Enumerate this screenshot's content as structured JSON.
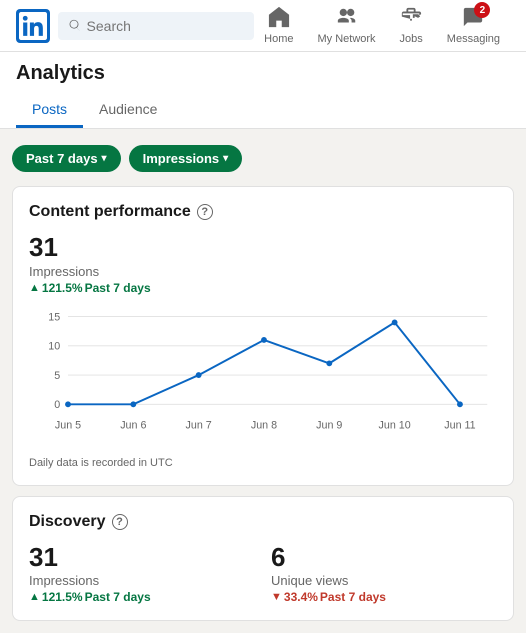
{
  "header": {
    "logo_alt": "LinkedIn",
    "search_placeholder": "Search",
    "nav": [
      {
        "id": "home",
        "label": "Home",
        "badge": null
      },
      {
        "id": "my-network",
        "label": "My Network",
        "badge": null
      },
      {
        "id": "jobs",
        "label": "Jobs",
        "badge": null
      },
      {
        "id": "messaging",
        "label": "Messaging",
        "badge": "2"
      }
    ]
  },
  "page": {
    "title": "Analytics",
    "tabs": [
      {
        "id": "posts",
        "label": "Posts",
        "active": true
      },
      {
        "id": "audience",
        "label": "Audience",
        "active": false
      }
    ]
  },
  "filters": [
    {
      "id": "date-range",
      "label": "Past 7 days"
    },
    {
      "id": "metric",
      "label": "Impressions"
    }
  ],
  "content_performance": {
    "title": "Content performance",
    "help_icon": "?",
    "metric_value": "31",
    "metric_label": "Impressions",
    "metric_change": "121.5%",
    "metric_change_period": "Past 7 days",
    "chart": {
      "y_max": 15,
      "y_labels": [
        "15",
        "10",
        "5",
        "0"
      ],
      "x_labels": [
        "Jun 5",
        "Jun 6",
        "Jun 7",
        "Jun 8",
        "Jun 9",
        "Jun 10",
        "Jun 11"
      ],
      "data_points": [
        {
          "x": 0,
          "y": 0
        },
        {
          "x": 1,
          "y": 0
        },
        {
          "x": 2,
          "y": 5
        },
        {
          "x": 3,
          "y": 11
        },
        {
          "x": 4,
          "y": 7
        },
        {
          "x": 5,
          "y": 14
        },
        {
          "x": 6,
          "y": 0
        }
      ],
      "note": "Daily data is recorded in UTC"
    }
  },
  "discovery": {
    "title": "Discovery",
    "help_icon": "?",
    "metrics": [
      {
        "id": "impressions",
        "value": "31",
        "label": "Impressions",
        "change": "121.5%",
        "change_dir": "up",
        "period": "Past 7 days"
      },
      {
        "id": "unique-views",
        "value": "6",
        "label": "Unique views",
        "change": "33.4%",
        "change_dir": "down",
        "period": "Past 7 days"
      }
    ]
  }
}
